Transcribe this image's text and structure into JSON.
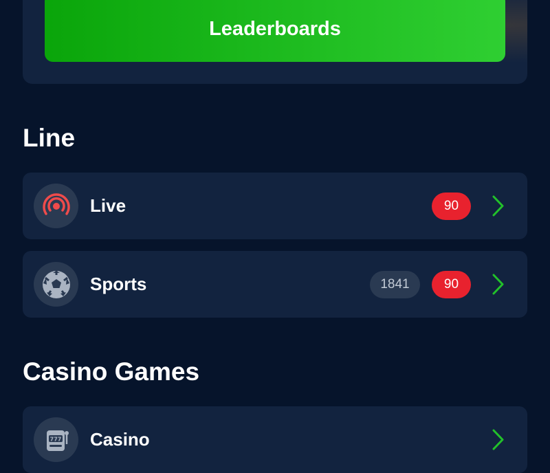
{
  "promo": {
    "button_label": "Leaderboards"
  },
  "sections": {
    "line": {
      "title": "Line",
      "items": [
        {
          "label": "Live",
          "count": "",
          "live_count": "90",
          "icon": "live-broadcast-icon"
        },
        {
          "label": "Sports",
          "count": "1841",
          "live_count": "90",
          "icon": "soccer-ball-icon"
        }
      ]
    },
    "casino": {
      "title": "Casino Games",
      "items": [
        {
          "label": "Casino",
          "icon": "slot-machine-icon"
        }
      ]
    }
  },
  "colors": {
    "background": "#06142b",
    "card": "#12233f",
    "accent_green": "#2fcf32",
    "badge_red": "#e8222e"
  }
}
